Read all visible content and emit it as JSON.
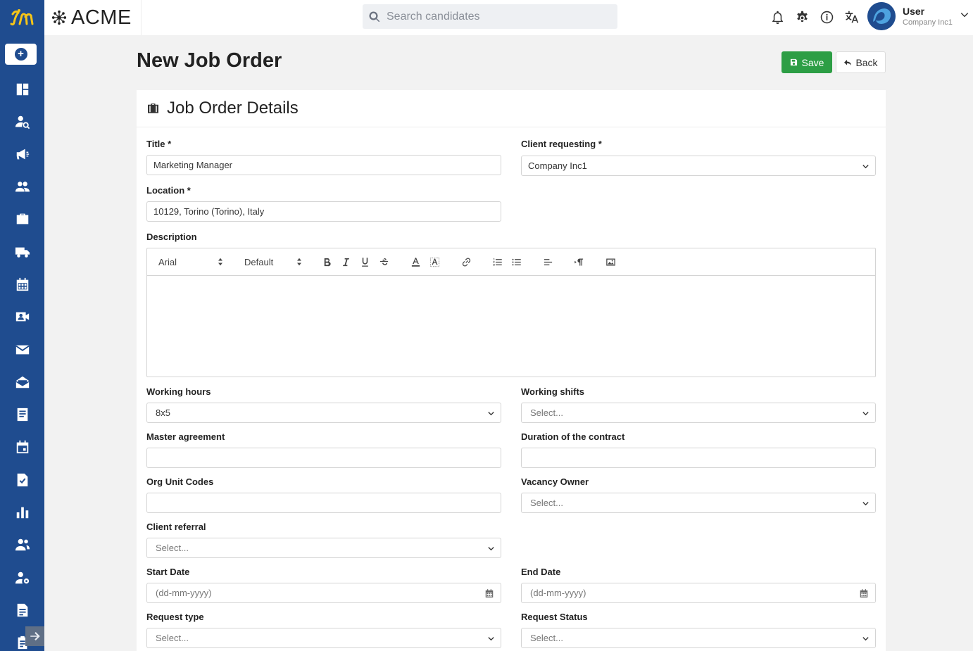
{
  "brand": {
    "name": "ACME"
  },
  "search": {
    "placeholder": "Search candidates"
  },
  "user": {
    "name": "User",
    "company": "Company Inc1"
  },
  "page": {
    "title": "New Job Order",
    "save_label": "Save",
    "back_label": "Back"
  },
  "card": {
    "title": "Job Order Details"
  },
  "form": {
    "title": {
      "label": "Title *",
      "value": "Marketing Manager"
    },
    "client": {
      "label": "Client requesting *",
      "value": "Company Inc1"
    },
    "location": {
      "label": "Location *",
      "value": "10129, Torino (Torino), Italy"
    },
    "description": {
      "label": "Description",
      "font": "Arial",
      "size": "Default"
    },
    "working_hours": {
      "label": "Working hours",
      "value": "8x5"
    },
    "working_shifts": {
      "label": "Working shifts",
      "value": "Select..."
    },
    "master_agreement": {
      "label": "Master agreement",
      "value": ""
    },
    "duration": {
      "label": "Duration of the contract",
      "value": ""
    },
    "org_unit": {
      "label": "Org Unit Codes",
      "value": ""
    },
    "vacancy_owner": {
      "label": "Vacancy Owner",
      "value": "Select..."
    },
    "client_referral": {
      "label": "Client referral",
      "value": "Select..."
    },
    "start_date": {
      "label": "Start Date",
      "placeholder": "(dd-mm-yyyy)"
    },
    "end_date": {
      "label": "End Date",
      "placeholder": "(dd-mm-yyyy)"
    },
    "request_type": {
      "label": "Request type",
      "value": "Select..."
    },
    "request_status": {
      "label": "Request Status",
      "value": "Select..."
    }
  },
  "icons": {
    "sidebar": [
      "dashboard-icon",
      "candidate-search-icon",
      "megaphone-icon",
      "users-icon",
      "briefcase-icon",
      "truck-icon",
      "calendar-icon",
      "video-contact-icon",
      "mail-icon",
      "mail-open-icon",
      "document-icon",
      "calendar-event-icon",
      "file-check-icon",
      "bar-chart-icon",
      "user-group-icon",
      "user-settings-icon",
      "file-text-icon",
      "clipboard-icon"
    ],
    "topbar": [
      "bell-icon",
      "gear-icon",
      "info-icon",
      "translate-icon"
    ]
  },
  "colors": {
    "sidebar": "#1f4c8f",
    "accent_yellow": "#f5c518",
    "save": "#2d9e45"
  }
}
